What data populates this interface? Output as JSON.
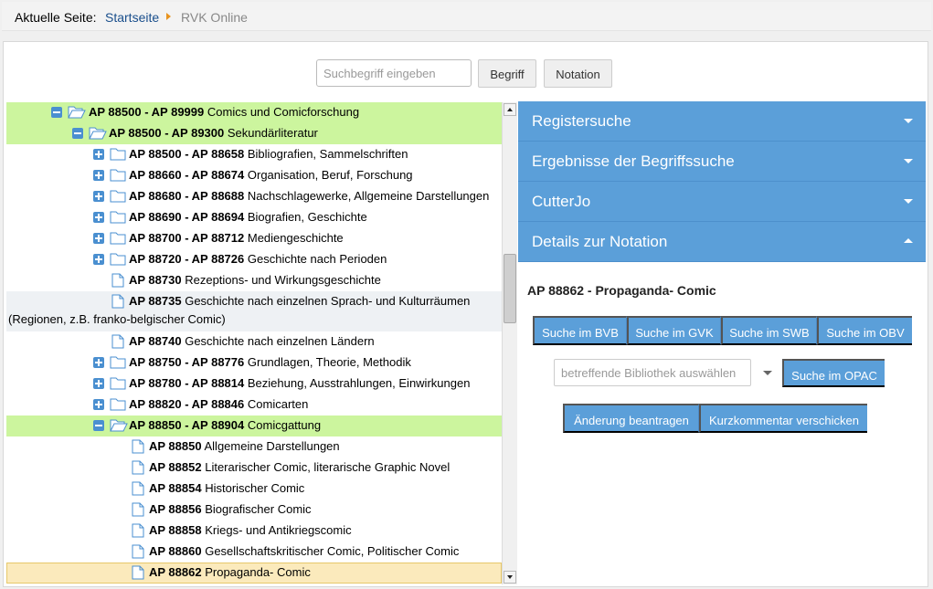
{
  "breadcrumb": {
    "label": "Aktuelle Seite:",
    "home": "Startseite",
    "current": "RVK Online"
  },
  "search": {
    "placeholder": "Suchbegriff eingeben",
    "term_button": "Begriff",
    "notation_button": "Notation"
  },
  "tree": {
    "rows": [
      {
        "code": "AP 88500 - AP 89999",
        "label": "Comics und Comicforschung"
      },
      {
        "code": "AP 88500 - AP 89300",
        "label": "Sekundärliteratur"
      },
      {
        "code": "AP 88500 - AP 88658",
        "label": "Bibliografien, Sammelschriften"
      },
      {
        "code": "AP 88660 - AP 88674",
        "label": "Organisation, Beruf, Forschung"
      },
      {
        "code": "AP 88680 - AP 88688",
        "label": "Nachschlagewerke, Allgemeine Darstellungen"
      },
      {
        "code": "AP 88690 - AP 88694",
        "label": "Biografien, Geschichte"
      },
      {
        "code": "AP 88700 - AP 88712",
        "label": "Mediengeschichte"
      },
      {
        "code": "AP 88720 - AP 88726",
        "label": "Geschichte nach Perioden"
      },
      {
        "code": "AP 88730",
        "label": "Rezeptions- und Wirkungsgeschichte"
      },
      {
        "code": "AP 88735",
        "label": "Geschichte nach einzelnen Sprach- und Kulturräumen",
        "label2": "(Regionen, z.B. franko-belgischer Comic)"
      },
      {
        "code": "AP 88740",
        "label": "Geschichte nach einzelnen Ländern"
      },
      {
        "code": "AP 88750 - AP 88776",
        "label": "Grundlagen, Theorie, Methodik"
      },
      {
        "code": "AP 88780 - AP 88814",
        "label": "Beziehung, Ausstrahlungen, Einwirkungen"
      },
      {
        "code": "AP 88820 - AP 88846",
        "label": "Comicarten"
      },
      {
        "code": "AP 88850 - AP 88904",
        "label": "Comicgattung"
      },
      {
        "code": "AP 88850",
        "label": "Allgemeine Darstellungen"
      },
      {
        "code": "AP 88852",
        "label": "Literarischer Comic, literarische Graphic Novel"
      },
      {
        "code": "AP 88854",
        "label": "Historischer Comic"
      },
      {
        "code": "AP 88856",
        "label": "Biografischer Comic"
      },
      {
        "code": "AP 88858",
        "label": "Kriegs- und Antikriegscomic"
      },
      {
        "code": "AP 88860",
        "label": "Gesellschaftskritischer Comic, Politischer Comic"
      },
      {
        "code": "AP 88862",
        "label": "Propaganda- Comic"
      }
    ]
  },
  "accordion": {
    "register": "Registersuche",
    "results": "Ergebnisse der Begriffssuche",
    "cutter": "CutterJo",
    "details": "Details zur Notation"
  },
  "details": {
    "title": "AP 88862 - Propaganda- Comic",
    "buttons": [
      "Suche im BVB",
      "Suche im GVK",
      "Suche im SWB",
      "Suche im OBV"
    ],
    "library_placeholder": "betreffende Bibliothek auswählen",
    "opac_button": "Suche im OPAC",
    "change_button": "Änderung beantragen",
    "comment_button": "Kurzkommentar verschicken"
  },
  "colors": {
    "accent": "#5b9fd9",
    "highlight_open": "#ccf59e",
    "highlight_selected": "#fbeabc",
    "link": "#1a4f8c"
  }
}
